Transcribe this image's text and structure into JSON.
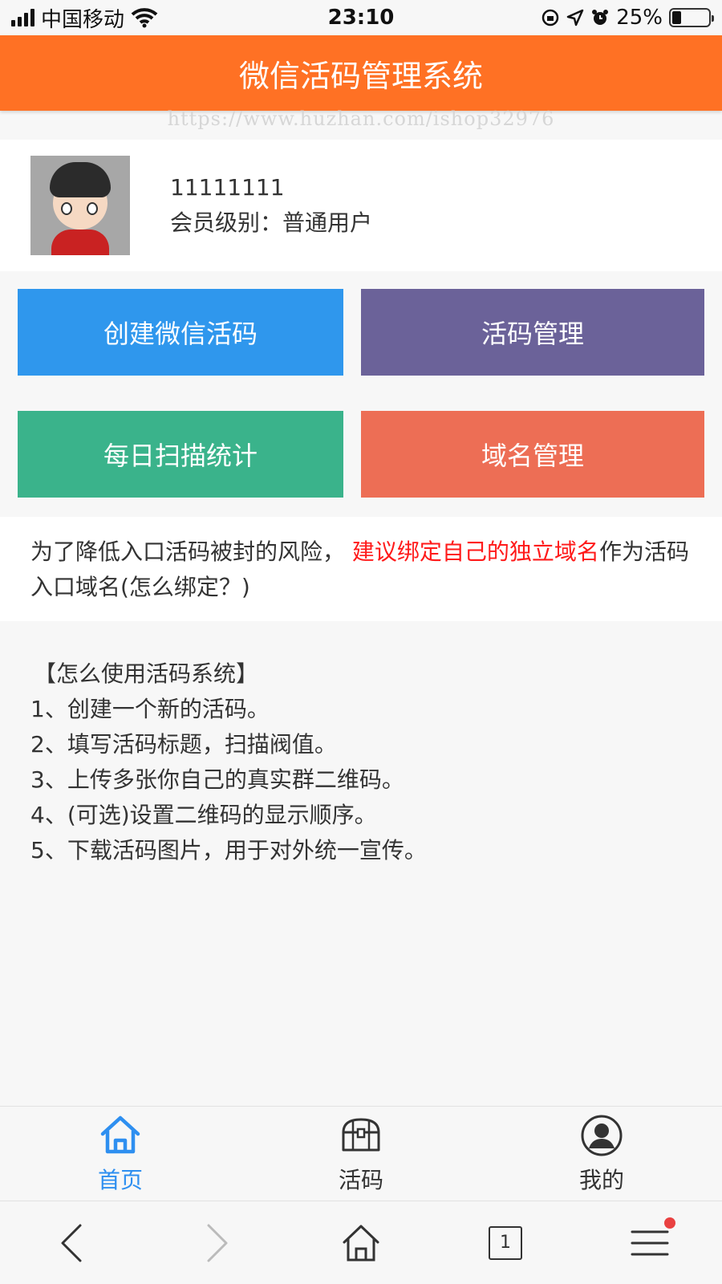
{
  "status_bar": {
    "carrier": "中国移动",
    "time": "23:10",
    "battery_percent": "25%",
    "battery_level": 0.25
  },
  "header": {
    "title": "微信活码管理系统"
  },
  "watermark": "https://www.huzhan.com/ishop32976",
  "profile": {
    "username": "11111111",
    "member_level": "会员级别：普通用户"
  },
  "actions": [
    {
      "label": "创建微信活码",
      "color": "#2f97ed"
    },
    {
      "label": "活码管理",
      "color": "#6b6299"
    },
    {
      "label": "每日扫描统计",
      "color": "#3ab38b"
    },
    {
      "label": "域名管理",
      "color": "#ed6e55"
    }
  ],
  "notice": {
    "text_before": "为了降低入口活码被封的风险，",
    "highlight": "建议绑定自己的独立域名",
    "text_after": "作为活码入口域名(怎么绑定？)",
    "highlight_color": "#ff1a1a"
  },
  "guide": {
    "title": "【怎么使用活码系统】",
    "steps": [
      "1、创建一个新的活码。",
      "2、填写活码标题，扫描阀值。",
      "3、上传多张你自己的真实群二维码。",
      "4、(可选)设置二维码的显示顺序。",
      "5、下载活码图片，用于对外统一宣传。"
    ]
  },
  "tabs": [
    {
      "label": "首页",
      "icon": "home-icon",
      "active": true
    },
    {
      "label": "活码",
      "icon": "treasure-chest-icon",
      "active": false
    },
    {
      "label": "我的",
      "icon": "user-icon",
      "active": false
    }
  ],
  "browser_bar": {
    "tab_count": "1"
  },
  "colors": {
    "header": "#ff7124",
    "active_tab": "#2e8ff0"
  }
}
